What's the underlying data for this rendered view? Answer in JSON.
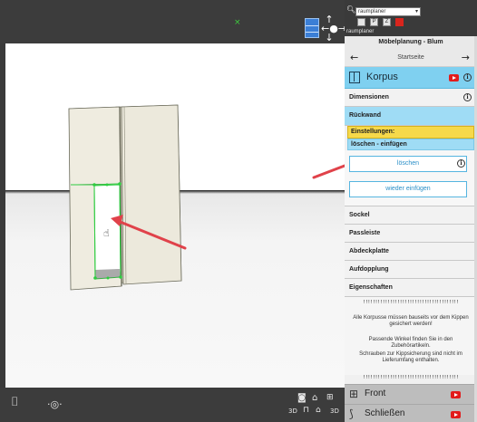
{
  "toolbar": {
    "dropdown_value": "raumplaner",
    "app_label": "raumplaner",
    "buttons": [
      "P",
      "Z",
      ""
    ]
  },
  "panel": {
    "title": "Möbelplanung - Blum",
    "nav_center": "Startseite",
    "korpus_label": "Korpus",
    "sections": {
      "dimensionen": "Dimensionen",
      "rueckwand": "Rückwand",
      "einstellungen": "Einstellungen:",
      "loeschen_einfuegen": "löschen - einfügen",
      "sockel": "Sockel",
      "passleiste": "Passleiste",
      "abdeckplatte": "Abdeckplatte",
      "aufdopplung": "Aufdopplung",
      "eigenschaften": "Eigenschaften"
    },
    "buttons": {
      "loeschen": "löschen",
      "wieder_einfuegen": "wieder einfügen"
    },
    "note": {
      "divider": "!!!!!!!!!!!!!!!!!!!!!!!!!!!!!!!!!!!!!!!!",
      "line1": "Alle Korpusse müssen bauseits vor dem Kippen gesichert werden!",
      "line2": "Passende Winkel finden Sie in den Zubehörartikeln.",
      "line3": "Schrauben zur Kippsicherung sind nicht im Lieferumfang enthalten."
    },
    "front_label": "Front",
    "schliessen_label": "Schließen"
  },
  "viewport": {
    "bottom_labels": {
      "view3d": "3D",
      "view3d_b": "3D"
    }
  },
  "colors": {
    "accent_blue": "#7fd0f0",
    "highlight_yellow": "#f6d94a",
    "arrow_red": "#e0424a",
    "panel_face": "#efece0",
    "edge_green": "#2ecc40"
  },
  "icons": [
    "search-icon",
    "nav-cube-icon",
    "move-arrows-icon",
    "cabinet-icon",
    "youtube-icon",
    "info-icon",
    "hand-cursor-icon",
    "door-icon",
    "orbit-icon",
    "home-icon"
  ]
}
